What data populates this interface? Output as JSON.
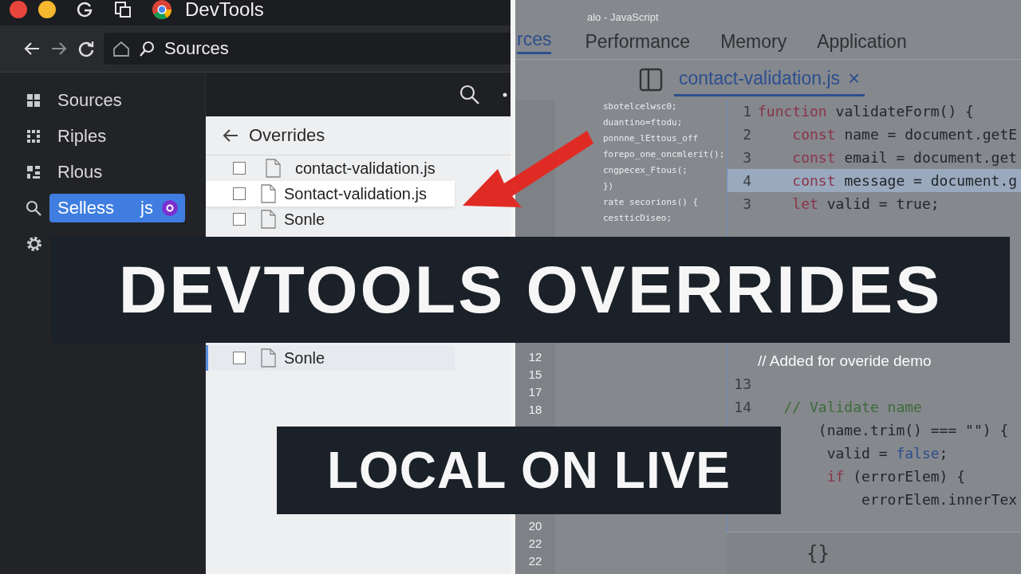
{
  "window": {
    "title": "DevTools"
  },
  "address_bar": {
    "value": "Sources"
  },
  "sidebar": {
    "items": [
      {
        "label": "Sources",
        "selected": false
      },
      {
        "label": "Riples",
        "selected": false
      },
      {
        "label": "Rlous",
        "selected": false
      },
      {
        "label": "Selless",
        "selected": true,
        "suffix": "js"
      }
    ]
  },
  "overrides": {
    "title": "Overrides",
    "groups": [
      [
        {
          "name": "contact-validation.js",
          "checked": false,
          "highlighted": false,
          "selected": false
        },
        {
          "name": "Sontact-validation.js",
          "checked": false,
          "highlighted": true,
          "selected": false
        },
        {
          "name": "Sonle",
          "checked": false,
          "highlighted": false,
          "selected": false
        }
      ],
      [
        {
          "name": "Sonle",
          "checked": false,
          "highlighted": false,
          "selected": true
        }
      ]
    ]
  },
  "editor": {
    "language": "alo - JavaScript",
    "tabs": [
      {
        "label": "rces",
        "selected": true
      },
      {
        "label": "Performance",
        "selected": false
      },
      {
        "label": "Memory",
        "selected": false
      },
      {
        "label": "Application",
        "selected": false
      }
    ],
    "file_tab": {
      "name": "contact-validation.js",
      "close": "×"
    },
    "ghost_lines": [
      "sbotelcelwsc0;",
      "duantino=ftodu;",
      "ponnne_lEttous_off",
      "forepo_one_oncmlerit();",
      "cngpecex_Ftous(;",
      "})",
      "rate secorions() {",
      "cestticDiseo;"
    ],
    "outer_gutter": [
      [
        "12",
        "15",
        "17",
        "18"
      ],
      [
        "20",
        "22",
        "22"
      ]
    ],
    "code_blocks": [
      [
        {
          "num": "1",
          "highlighted": false,
          "tokens": [
            {
              "t": "function",
              "kind": "kw"
            },
            {
              "t": " validateForm() {",
              "kind": "id"
            }
          ]
        },
        {
          "num": "2",
          "highlighted": false,
          "tokens": [
            {
              "t": "    const",
              "kind": "kw"
            },
            {
              "t": " name = document.getE",
              "kind": "id"
            }
          ]
        },
        {
          "num": "3",
          "highlighted": false,
          "tokens": [
            {
              "t": "    const",
              "kind": "kw"
            },
            {
              "t": " email = document.get",
              "kind": "id"
            }
          ]
        },
        {
          "num": "4",
          "highlighted": true,
          "tokens": [
            {
              "t": "    const",
              "kind": "kw"
            },
            {
              "t": " message = document.g",
              "kind": "id"
            }
          ]
        },
        {
          "num": "3",
          "highlighted": false,
          "tokens": [
            {
              "t": "    let",
              "kind": "kw"
            },
            {
              "t": " valid = true;",
              "kind": "id"
            }
          ]
        }
      ],
      [
        {
          "highlighted": false,
          "tokens": [
            {
              "t": "// Added for overide demo",
              "kind": "note"
            }
          ]
        },
        {
          "num": "13",
          "highlighted": false
        },
        {
          "num": "14",
          "highlighted": false,
          "tokens": [
            {
              "t": "   // Validate name",
              "kind": "comment"
            }
          ]
        },
        {
          "highlighted": false,
          "tokens": [
            {
              "t": "       (name.trim() === \"\") {",
              "kind": "id"
            }
          ]
        },
        {
          "highlighted": false,
          "tokens": [
            {
              "t": "        valid = ",
              "kind": "id"
            },
            {
              "t": "false",
              "kind": "lit"
            },
            {
              "t": ";",
              "kind": "id"
            }
          ]
        },
        {
          "highlighted": false,
          "tokens": [
            {
              "t": "        if",
              "kind": "kw"
            },
            {
              "t": " (errorElem) {",
              "kind": "id"
            }
          ]
        },
        {
          "highlighted": false,
          "tokens": [
            {
              "t": "            errorElem.innerTex",
              "kind": "id"
            }
          ]
        }
      ]
    ],
    "footer": "{}"
  },
  "banners": [
    {
      "text": "DEVTOOLS OVERRIDES",
      "kind": "main"
    },
    {
      "text": "LOCAL ON LIVE",
      "kind": "sub"
    }
  ]
}
